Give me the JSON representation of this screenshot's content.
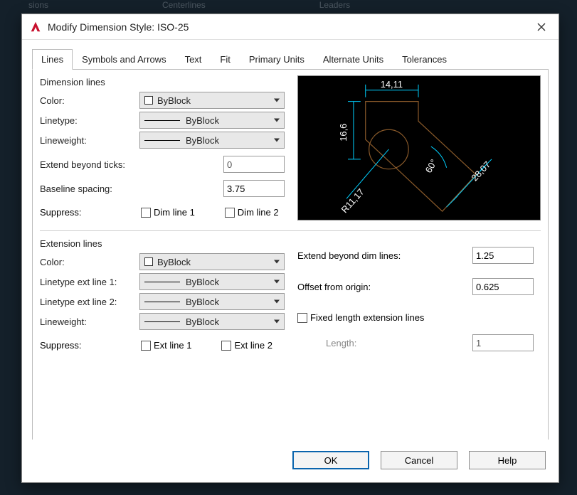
{
  "bg_ribbon": {
    "items": [
      "sions",
      "Centerlines",
      "Leaders"
    ]
  },
  "window": {
    "title": "Modify Dimension Style: ISO-25"
  },
  "tabs": [
    {
      "label": "Lines",
      "active": true
    },
    {
      "label": "Symbols and Arrows"
    },
    {
      "label": "Text"
    },
    {
      "label": "Fit"
    },
    {
      "label": "Primary Units"
    },
    {
      "label": "Alternate Units"
    },
    {
      "label": "Tolerances"
    }
  ],
  "dim_lines": {
    "legend": "Dimension lines",
    "color_label": "Color:",
    "color_value": "ByBlock",
    "linetype_label": "Linetype:",
    "linetype_value": "ByBlock",
    "lineweight_label": "Lineweight:",
    "lineweight_value": "ByBlock",
    "extend_ticks_label": "Extend beyond ticks:",
    "extend_ticks_value": "0",
    "baseline_spacing_label": "Baseline spacing:",
    "baseline_spacing_value": "3.75",
    "suppress_label": "Suppress:",
    "suppress1": "Dim line 1",
    "suppress2": "Dim line 2"
  },
  "ext_lines": {
    "legend": "Extension lines",
    "color_label": "Color:",
    "color_value": "ByBlock",
    "ltype1_label": "Linetype ext line 1:",
    "ltype1_value": "ByBlock",
    "ltype2_label": "Linetype ext line 2:",
    "ltype2_value": "ByBlock",
    "lineweight_label": "Lineweight:",
    "lineweight_value": "ByBlock",
    "suppress_label": "Suppress:",
    "suppress1": "Ext line 1",
    "suppress2": "Ext line 2",
    "extend_beyond_label": "Extend beyond dim lines:",
    "extend_beyond_value": "1.25",
    "offset_label": "Offset from origin:",
    "offset_value": "0.625",
    "fixed_len_label": "Fixed length extension lines",
    "length_label": "Length:",
    "length_value": "1"
  },
  "preview": {
    "dim_top": "14,11",
    "dim_left": "16,6",
    "dim_diag": "28,07",
    "dim_angle": "60°",
    "dim_radius": "R11,17"
  },
  "buttons": {
    "ok": "OK",
    "cancel": "Cancel",
    "help": "Help"
  }
}
